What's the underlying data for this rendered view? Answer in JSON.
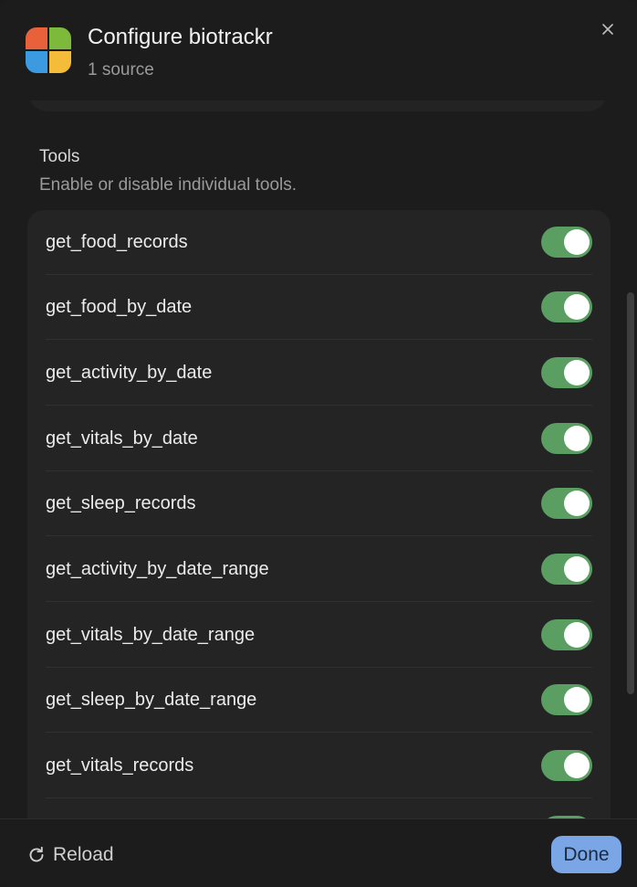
{
  "header": {
    "title": "Configure biotrackr",
    "subtitle": "1 source",
    "logo_colors": [
      "#e8613a",
      "#7dba3c",
      "#3b9ae0",
      "#f5bc3a"
    ]
  },
  "tools_section": {
    "title": "Tools",
    "description": "Enable or disable individual tools."
  },
  "tools": [
    {
      "name": "get_food_records",
      "enabled": true
    },
    {
      "name": "get_food_by_date",
      "enabled": true
    },
    {
      "name": "get_activity_by_date",
      "enabled": true
    },
    {
      "name": "get_vitals_by_date",
      "enabled": true
    },
    {
      "name": "get_sleep_records",
      "enabled": true
    },
    {
      "name": "get_activity_by_date_range",
      "enabled": true
    },
    {
      "name": "get_vitals_by_date_range",
      "enabled": true
    },
    {
      "name": "get_sleep_by_date_range",
      "enabled": true
    },
    {
      "name": "get_vitals_records",
      "enabled": true
    },
    {
      "name": "",
      "enabled": true
    }
  ],
  "footer": {
    "reload_label": "Reload",
    "done_label": "Done"
  },
  "colors": {
    "toggle_on": "#5a9e62",
    "done_button": "#7aa6e6"
  },
  "icons": {
    "close": "close-icon",
    "reload": "reload-icon"
  }
}
